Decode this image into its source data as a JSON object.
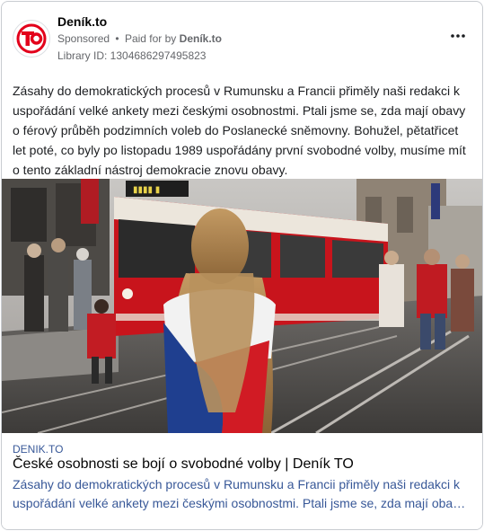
{
  "ad": {
    "page_name": "Deník.to",
    "sponsored_label": "Sponsored",
    "separator": "•",
    "paid_for_by_label": "Paid for by",
    "paid_for_by_name": "Deník.to",
    "library_id": "Library ID: 1304686297495823",
    "logo_text": "TO",
    "more_icon": "more-horizontal-icon",
    "body_text": "Zásahy do demokratických procesů v Rumunsku a Francii přiměly naši redakci k uspořádání velké ankety mezi českými osobnostmi. Ptali jsme se, zda mají obavy o férový průběh podzimních voleb do Poslanecké sněmovny. Bohužel, pětatřicet let poté, co byly po listopadu 1989 uspořádány první svobodné volby, musíme mít o tento základní nástroj demokracie znovu obavy."
  },
  "link": {
    "domain": "DENIK.TO",
    "title": "České osobnosti se bojí o svobodné volby | Deník TO",
    "description": "Zásahy do demokratických procesů v Rumunsku a Francii přiměly naši redakci k uspořádání velké ankety mezi českými osobnostmi. Ptali jsme se, zda mají obavy o férový průběh podzimních voleb do Poslanecké sněmovny."
  },
  "colors": {
    "brand_red": "#e3001b",
    "link_blue": "#385898",
    "secondary_text": "#65676b",
    "tram_red": "#c8141c",
    "flag_blue": "#1f3f8f",
    "flag_white": "#f2f2f2"
  }
}
